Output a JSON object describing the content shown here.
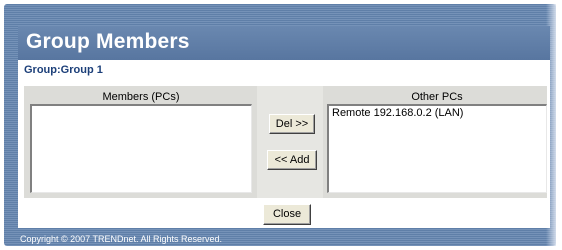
{
  "title": "Group Members",
  "group": {
    "prefix": "Group:",
    "name": "Group 1"
  },
  "members": {
    "label": "Members (PCs)",
    "items": []
  },
  "others": {
    "label": "Other PCs",
    "items": [
      "Remote 192.168.0.2 (LAN)"
    ]
  },
  "buttons": {
    "del": "Del >>",
    "add": "<< Add",
    "close": "Close"
  },
  "footer": {
    "copyright": "Copyright © 2007 TRENDnet. All Rights Reserved."
  },
  "colors": {
    "header": "#5876a0",
    "group_text": "#1c3f79",
    "panel": "#dcdcd8"
  }
}
